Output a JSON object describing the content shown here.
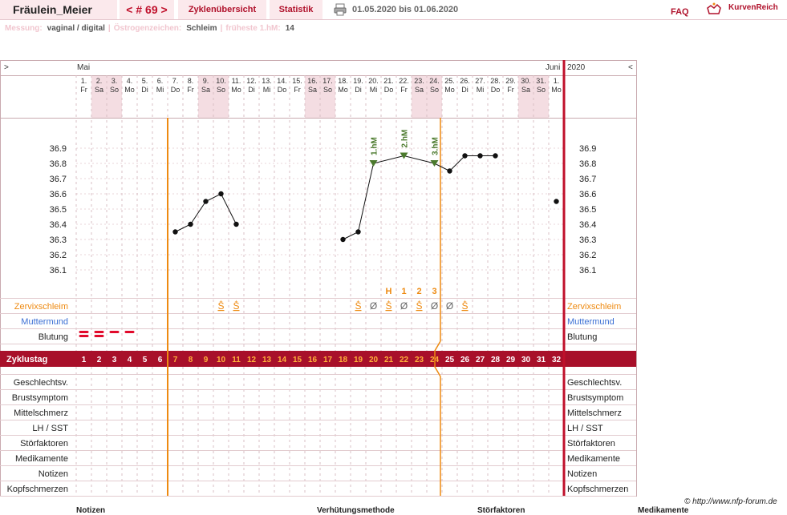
{
  "header": {
    "username": "Fräulein_Meier",
    "cycle_label": "< # 69 >",
    "tabs": [
      "Zyklenübersicht",
      "Statistik"
    ],
    "date_range": "01.05.2020 bis 01.06.2020",
    "faq": "FAQ",
    "logo_text": "KurvenReich"
  },
  "meta": {
    "measurement_label": "Messung:",
    "measurement_value": "vaginal / digital",
    "estrogen_label": "Östrogenzeichen:",
    "estrogen_value": "Schleim",
    "earliest_label": "früheste 1.hM:",
    "earliest_value": "14"
  },
  "chart_data": {
    "type": "line",
    "nav_left": ">",
    "nav_right": "<",
    "month_start": "Mai",
    "month_end": "Juni",
    "year": "2020",
    "days": [
      {
        "d": "1.",
        "w": "Fr"
      },
      {
        "d": "2.",
        "w": "Sa"
      },
      {
        "d": "3.",
        "w": "So"
      },
      {
        "d": "4.",
        "w": "Mo"
      },
      {
        "d": "5.",
        "w": "Di"
      },
      {
        "d": "6.",
        "w": "Mi"
      },
      {
        "d": "7.",
        "w": "Do"
      },
      {
        "d": "8.",
        "w": "Fr"
      },
      {
        "d": "9.",
        "w": "Sa"
      },
      {
        "d": "10.",
        "w": "So"
      },
      {
        "d": "11.",
        "w": "Mo"
      },
      {
        "d": "12.",
        "w": "Di"
      },
      {
        "d": "13.",
        "w": "Mi"
      },
      {
        "d": "14.",
        "w": "Do"
      },
      {
        "d": "15.",
        "w": "Fr"
      },
      {
        "d": "16.",
        "w": "Sa"
      },
      {
        "d": "17.",
        "w": "So"
      },
      {
        "d": "18.",
        "w": "Mo"
      },
      {
        "d": "19.",
        "w": "Di"
      },
      {
        "d": "20.",
        "w": "Mi"
      },
      {
        "d": "21.",
        "w": "Do"
      },
      {
        "d": "22.",
        "w": "Fr"
      },
      {
        "d": "23.",
        "w": "Sa"
      },
      {
        "d": "24.",
        "w": "So"
      },
      {
        "d": "25.",
        "w": "Mo"
      },
      {
        "d": "26.",
        "w": "Di"
      },
      {
        "d": "27.",
        "w": "Mi"
      },
      {
        "d": "28.",
        "w": "Do"
      },
      {
        "d": "29.",
        "w": "Fr"
      },
      {
        "d": "30.",
        "w": "Sa"
      },
      {
        "d": "31.",
        "w": "So"
      },
      {
        "d": "1.",
        "w": "Mo"
      }
    ],
    "y_ticks": [
      "36.9",
      "36.8",
      "36.7",
      "36.6",
      "36.5",
      "36.4",
      "36.3",
      "36.2",
      "36.1"
    ],
    "temperatures": [
      {
        "day": 7,
        "temp": 36.35
      },
      {
        "day": 8,
        "temp": 36.4
      },
      {
        "day": 9,
        "temp": 36.55
      },
      {
        "day": 10,
        "temp": 36.6
      },
      {
        "day": 11,
        "temp": 36.4
      },
      {
        "day": 18,
        "temp": 36.3
      },
      {
        "day": 19,
        "temp": 36.35
      },
      {
        "day": 20,
        "temp": 36.8
      },
      {
        "day": 22,
        "temp": 36.85
      },
      {
        "day": 24,
        "temp": 36.8
      },
      {
        "day": 25,
        "temp": 36.75
      },
      {
        "day": 26,
        "temp": 36.85
      },
      {
        "day": 27,
        "temp": 36.85
      },
      {
        "day": 28,
        "temp": 36.85
      },
      {
        "day": 32,
        "temp": 36.55
      }
    ],
    "hm_markers": [
      {
        "day": 20,
        "label": "1.hM"
      },
      {
        "day": 22,
        "label": "2.hM"
      },
      {
        "day": 24,
        "label": "3.hM"
      }
    ],
    "peak_labels": [
      {
        "day": 21,
        "label": "H"
      },
      {
        "day": 22,
        "label": "1"
      },
      {
        "day": 23,
        "label": "2"
      },
      {
        "day": 24,
        "label": "3"
      }
    ],
    "rows": {
      "cervical_mucus": "Zervixschleim",
      "cervix": "Muttermund",
      "bleeding": "Blutung",
      "cycle_day": "Zyklustag"
    },
    "mucus_symbols": [
      {
        "day": 10,
        "s": "S"
      },
      {
        "day": 11,
        "s": "S"
      },
      {
        "day": 19,
        "s": "S"
      },
      {
        "day": 20,
        "s": "Ø"
      },
      {
        "day": 21,
        "s": "S"
      },
      {
        "day": 22,
        "s": "Ø"
      },
      {
        "day": 23,
        "s": "S"
      },
      {
        "day": 24,
        "s": "Ø"
      },
      {
        "day": 25,
        "s": "Ø"
      },
      {
        "day": 26,
        "s": "S"
      }
    ],
    "bleeding_days": [
      {
        "day": 1,
        "level": 2
      },
      {
        "day": 2,
        "level": 2
      },
      {
        "day": 3,
        "level": 1
      },
      {
        "day": 4,
        "level": 1
      }
    ],
    "cycle_days": [
      "1",
      "2",
      "3",
      "4",
      "5",
      "6",
      "7",
      "8",
      "9",
      "10",
      "11",
      "12",
      "13",
      "14",
      "15",
      "16",
      "17",
      "18",
      "19",
      "20",
      "21",
      "22",
      "23",
      "24",
      "25",
      "26",
      "27",
      "28",
      "29",
      "30",
      "31",
      "32"
    ],
    "fertile_start_day": 7,
    "infertile_start_day": 24,
    "bottom_rows": [
      "Geschlechtsv.",
      "Brustsymptom",
      "Mittelschmerz",
      "LH / SST",
      "Störfaktoren",
      "Medikamente",
      "Notizen",
      "Kopfschmerzen"
    ]
  },
  "footer": {
    "copyright": "© http://www.nfp-forum.de",
    "bottom_labels": [
      "Notizen",
      "Verhütungsmethode",
      "Störfaktoren",
      "Medikamente"
    ]
  },
  "colors": {
    "accent": "#b0112b",
    "orange": "#ee8a11",
    "green": "#4b7a2d",
    "weekend": "#f4dde2",
    "grid": "#c9aaaf"
  }
}
